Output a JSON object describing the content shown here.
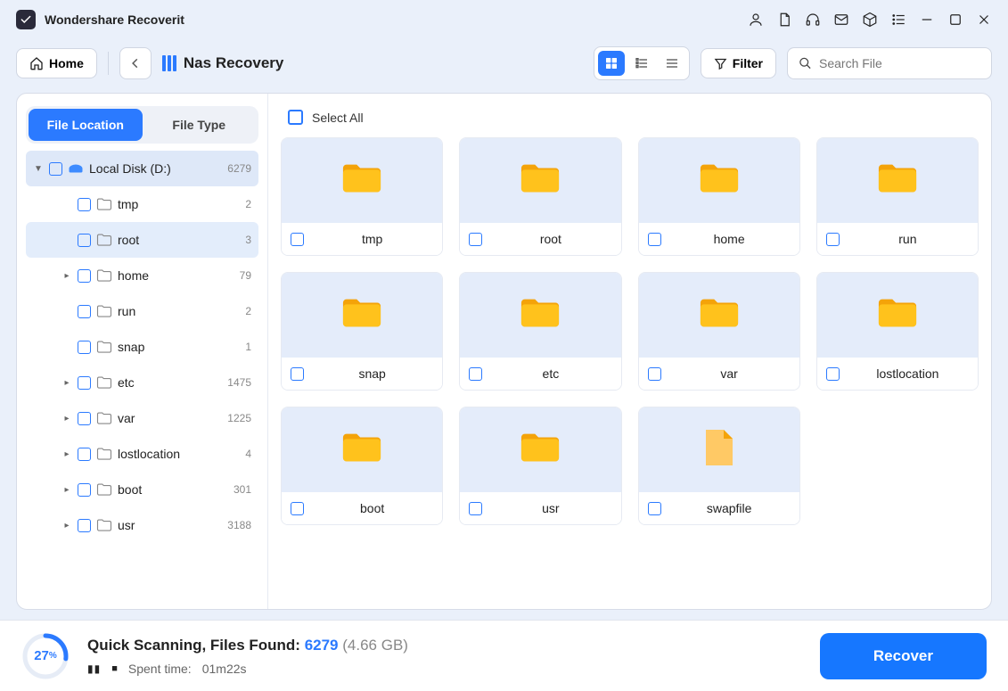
{
  "app": {
    "title": "Wondershare Recoverit"
  },
  "toolbar": {
    "home": "Home",
    "breadcrumb": "Nas Recovery",
    "filter": "Filter",
    "search_placeholder": "Search File"
  },
  "sidebar": {
    "tabs": {
      "location": "File Location",
      "type": "File Type"
    },
    "disk": {
      "label": "Local Disk (D:)",
      "count": "6279"
    },
    "tree": [
      {
        "label": "tmp",
        "count": "2",
        "expandable": false
      },
      {
        "label": "root",
        "count": "3",
        "expandable": false,
        "selected": true
      },
      {
        "label": "home",
        "count": "79",
        "expandable": true
      },
      {
        "label": "run",
        "count": "2",
        "expandable": false
      },
      {
        "label": "snap",
        "count": "1",
        "expandable": false
      },
      {
        "label": "etc",
        "count": "1475",
        "expandable": true
      },
      {
        "label": "var",
        "count": "1225",
        "expandable": true
      },
      {
        "label": "lostlocation",
        "count": "4",
        "expandable": true
      },
      {
        "label": "boot",
        "count": "301",
        "expandable": true
      },
      {
        "label": "usr",
        "count": "3188",
        "expandable": true
      }
    ]
  },
  "content": {
    "select_all": "Select All",
    "items": [
      {
        "name": "tmp",
        "type": "folder"
      },
      {
        "name": "root",
        "type": "folder"
      },
      {
        "name": "home",
        "type": "folder"
      },
      {
        "name": "run",
        "type": "folder"
      },
      {
        "name": "snap",
        "type": "folder"
      },
      {
        "name": "etc",
        "type": "folder"
      },
      {
        "name": "var",
        "type": "folder"
      },
      {
        "name": "lostlocation",
        "type": "folder"
      },
      {
        "name": "boot",
        "type": "folder"
      },
      {
        "name": "usr",
        "type": "folder"
      },
      {
        "name": "swapfile",
        "type": "file"
      }
    ]
  },
  "footer": {
    "percent": "27",
    "percent_sym": "%",
    "title_prefix": "Quick Scanning, Files Found: ",
    "found": "6279",
    "size": "(4.66 GB)",
    "spent_label": "Spent time:",
    "spent_value": "01m22s",
    "recover": "Recover"
  }
}
